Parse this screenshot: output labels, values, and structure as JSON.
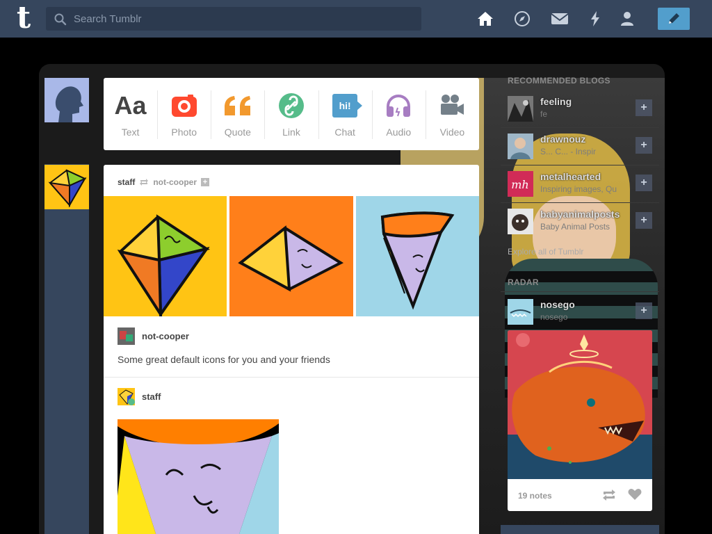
{
  "header": {
    "logo": "t",
    "search_placeholder": "Search Tumblr",
    "nav": [
      "home-icon",
      "explore-compass-icon",
      "inbox-mail-icon",
      "activity-lightning-icon",
      "account-person-icon"
    ],
    "compose_icon": "pencil-icon",
    "bg_color": "#36465d",
    "accent_color": "#529ecc"
  },
  "post_types": [
    {
      "label": "Text",
      "icon": "text-aa-icon",
      "glyph": "Aa",
      "color": "#444444"
    },
    {
      "label": "Photo",
      "icon": "camera-icon",
      "color": "#ff492f"
    },
    {
      "label": "Quote",
      "icon": "quote-icon",
      "color": "#f2992e"
    },
    {
      "label": "Link",
      "icon": "link-icon",
      "color": "#56bc8a"
    },
    {
      "label": "Chat",
      "icon": "chat-icon",
      "glyph": "hi!",
      "color": "#529ecc"
    },
    {
      "label": "Audio",
      "icon": "headphones-icon",
      "color": "#a77dc2"
    },
    {
      "label": "Video",
      "icon": "video-camera-icon",
      "color": "#748089"
    }
  ],
  "post": {
    "author": "staff",
    "reblogged_from": "not-cooper",
    "source_name": "not-cooper",
    "caption": "Some great default icons for you and your friends",
    "second_author": "staff"
  },
  "sidebar": {
    "recommended_title": "RECOMMENDED BLOGS",
    "recommended": [
      {
        "name": "feeling",
        "sub": "fe"
      },
      {
        "name": "drawnouz",
        "sub": "S... C... - Inspir"
      },
      {
        "name": "metalhearted",
        "sub": "Inspiring images, Qu"
      },
      {
        "name": "babyanimalposts",
        "sub": "Baby Animal Posts"
      }
    ],
    "explore_link": "Explore all of Tumblr",
    "radar_title": "RADAR",
    "radar_blog": {
      "name": "nosego",
      "sub": "nosego"
    },
    "radar_notes": "19 notes"
  }
}
